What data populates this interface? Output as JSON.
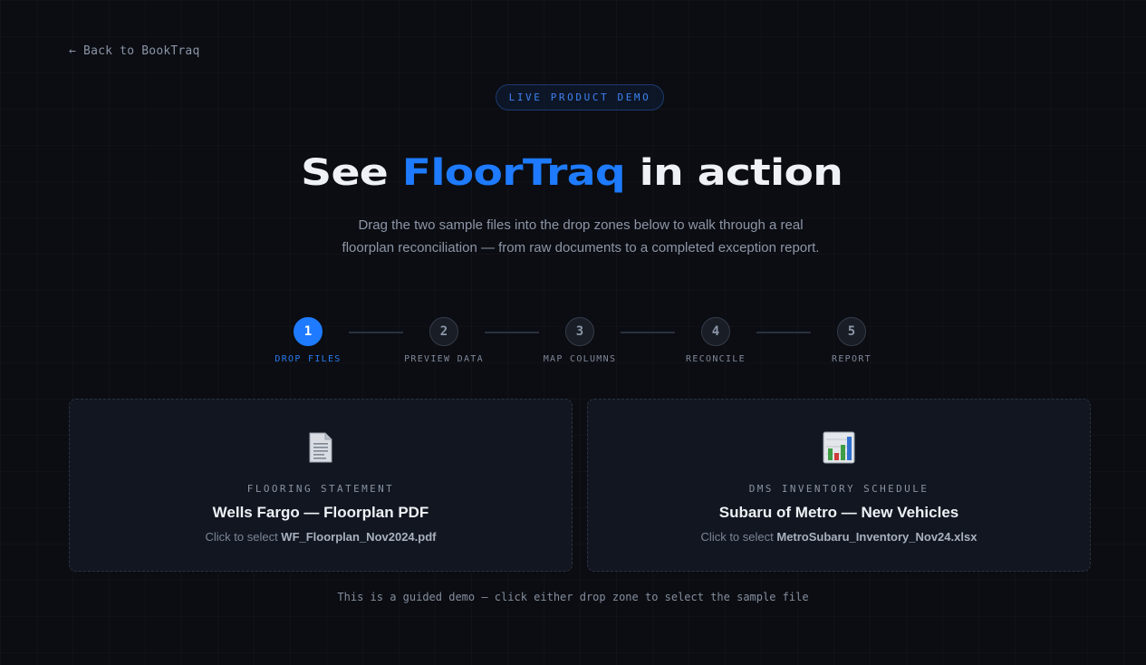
{
  "nav": {
    "back_label": "← Back to BookTraq"
  },
  "hero": {
    "badge": "LIVE PRODUCT DEMO",
    "title_prefix": "See ",
    "title_accent": "FloorTraq",
    "title_suffix": " in action",
    "subtitle": "Drag the two sample files into the drop zones below to walk through a real floorplan reconciliation — from raw documents to a completed exception report."
  },
  "steps": [
    {
      "number": "1",
      "label": "DROP FILES",
      "active": true
    },
    {
      "number": "2",
      "label": "PREVIEW DATA",
      "active": false
    },
    {
      "number": "3",
      "label": "MAP COLUMNS",
      "active": false
    },
    {
      "number": "4",
      "label": "RECONCILE",
      "active": false
    },
    {
      "number": "5",
      "label": "REPORT",
      "active": false
    }
  ],
  "dropzones": [
    {
      "icon": "document-icon",
      "kicker": "FLOORING STATEMENT",
      "title": "Wells Fargo — Floorplan PDF",
      "hint_prefix": "Click to select ",
      "filename": "WF_Floorplan_Nov2024.pdf"
    },
    {
      "icon": "bar-chart-icon",
      "kicker": "DMS INVENTORY SCHEDULE",
      "title": "Subaru of Metro — New Vehicles",
      "hint_prefix": "Click to select ",
      "filename": "MetroSubaru_Inventory_Nov24.xlsx"
    }
  ],
  "footer": {
    "note": "This is a guided demo — click either drop zone to select the sample file"
  },
  "colors": {
    "accent": "#1e7bff",
    "background": "#0b0d12",
    "card": "#111620"
  }
}
